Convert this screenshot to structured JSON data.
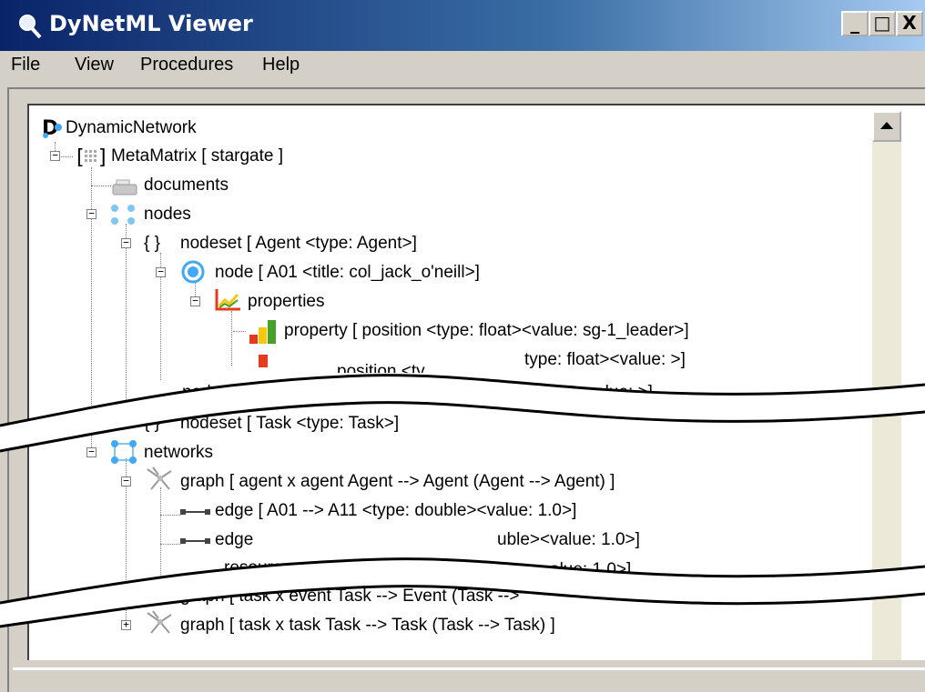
{
  "window": {
    "title": "DyNetML Viewer",
    "minimize_label": "_",
    "maximize_label": "□",
    "close_label": "X"
  },
  "menu": [
    "File",
    "View",
    "Procedures",
    "Help"
  ],
  "tree": {
    "root": "DynamicNetwork",
    "metamatrix": "MetaMatrix [ stargate ]",
    "documents": "documents",
    "nodes": "nodes",
    "nodeset_agent": "nodeset [ Agent <type: Agent>]",
    "node_a01": "node [ A01 <title: col_jack_o'neill>]",
    "properties": "properties",
    "property_position": "property [ position <type: float><value: sg-1_leader>]",
    "fragment_type_float": "type: float><value: >]",
    "fragment_position": "position <ty",
    "nodeset_resource": "nodeset [ Resource <type: Resource>",
    "fragment_float_value": "oat><value: >]",
    "nodeset_task": "nodeset [ Task <type: Task>]",
    "fragment_close": "]",
    "networks": "networks",
    "graph_agent": "graph [ agent x agent Agent --> Agent (Agent --> Agent) ]",
    "edge_a01_a11": "edge [ A01 --> A11 <type: double><value: 1.0>]",
    "edge_partial": "edge",
    "fragment_double_value": "uble><value: 1.0>]",
    "graph_resource": "resource x task Resource -->",
    "fragment_value_1": "alue: 1.0>]",
    "graph_task_event": "graph [ task x event Task --> Event (Task -->",
    "graph_task_task": "graph [ task x task Task --> Task (Task --> Task) ]"
  },
  "colors": {
    "title_start": "#0a246a",
    "title_end": "#a6caf0",
    "chrome": "#d4d0c8",
    "node_blue": "#3fa9f5",
    "property_red": "#e53b1d",
    "property_green": "#45a12a",
    "property_yellow": "#f5c70f"
  }
}
